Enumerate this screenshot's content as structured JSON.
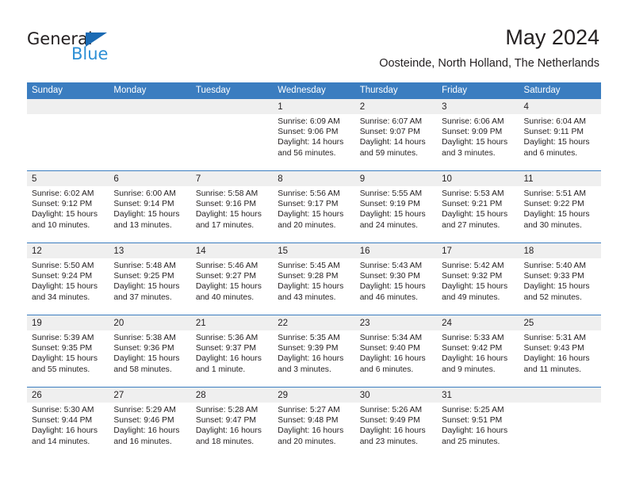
{
  "brand": {
    "name_top": "General",
    "name_bottom": "Blue",
    "triangle_color": "#1b6ab3",
    "blue_color": "#2d8fd5"
  },
  "header": {
    "title": "May 2024",
    "subtitle": "Oosteinde, North Holland, The Netherlands"
  },
  "theme": {
    "header_bg": "#3b7dc0",
    "day_band_bg": "#efefef",
    "text": "#231f20"
  },
  "weekdays": [
    "Sunday",
    "Monday",
    "Tuesday",
    "Wednesday",
    "Thursday",
    "Friday",
    "Saturday"
  ],
  "weeks": [
    [
      {
        "day": "",
        "sunrise": "",
        "sunset": "",
        "daylight1": "",
        "daylight2": ""
      },
      {
        "day": "",
        "sunrise": "",
        "sunset": "",
        "daylight1": "",
        "daylight2": ""
      },
      {
        "day": "",
        "sunrise": "",
        "sunset": "",
        "daylight1": "",
        "daylight2": ""
      },
      {
        "day": "1",
        "sunrise": "Sunrise: 6:09 AM",
        "sunset": "Sunset: 9:06 PM",
        "daylight1": "Daylight: 14 hours",
        "daylight2": "and 56 minutes."
      },
      {
        "day": "2",
        "sunrise": "Sunrise: 6:07 AM",
        "sunset": "Sunset: 9:07 PM",
        "daylight1": "Daylight: 14 hours",
        "daylight2": "and 59 minutes."
      },
      {
        "day": "3",
        "sunrise": "Sunrise: 6:06 AM",
        "sunset": "Sunset: 9:09 PM",
        "daylight1": "Daylight: 15 hours",
        "daylight2": "and 3 minutes."
      },
      {
        "day": "4",
        "sunrise": "Sunrise: 6:04 AM",
        "sunset": "Sunset: 9:11 PM",
        "daylight1": "Daylight: 15 hours",
        "daylight2": "and 6 minutes."
      }
    ],
    [
      {
        "day": "5",
        "sunrise": "Sunrise: 6:02 AM",
        "sunset": "Sunset: 9:12 PM",
        "daylight1": "Daylight: 15 hours",
        "daylight2": "and 10 minutes."
      },
      {
        "day": "6",
        "sunrise": "Sunrise: 6:00 AM",
        "sunset": "Sunset: 9:14 PM",
        "daylight1": "Daylight: 15 hours",
        "daylight2": "and 13 minutes."
      },
      {
        "day": "7",
        "sunrise": "Sunrise: 5:58 AM",
        "sunset": "Sunset: 9:16 PM",
        "daylight1": "Daylight: 15 hours",
        "daylight2": "and 17 minutes."
      },
      {
        "day": "8",
        "sunrise": "Sunrise: 5:56 AM",
        "sunset": "Sunset: 9:17 PM",
        "daylight1": "Daylight: 15 hours",
        "daylight2": "and 20 minutes."
      },
      {
        "day": "9",
        "sunrise": "Sunrise: 5:55 AM",
        "sunset": "Sunset: 9:19 PM",
        "daylight1": "Daylight: 15 hours",
        "daylight2": "and 24 minutes."
      },
      {
        "day": "10",
        "sunrise": "Sunrise: 5:53 AM",
        "sunset": "Sunset: 9:21 PM",
        "daylight1": "Daylight: 15 hours",
        "daylight2": "and 27 minutes."
      },
      {
        "day": "11",
        "sunrise": "Sunrise: 5:51 AM",
        "sunset": "Sunset: 9:22 PM",
        "daylight1": "Daylight: 15 hours",
        "daylight2": "and 30 minutes."
      }
    ],
    [
      {
        "day": "12",
        "sunrise": "Sunrise: 5:50 AM",
        "sunset": "Sunset: 9:24 PM",
        "daylight1": "Daylight: 15 hours",
        "daylight2": "and 34 minutes."
      },
      {
        "day": "13",
        "sunrise": "Sunrise: 5:48 AM",
        "sunset": "Sunset: 9:25 PM",
        "daylight1": "Daylight: 15 hours",
        "daylight2": "and 37 minutes."
      },
      {
        "day": "14",
        "sunrise": "Sunrise: 5:46 AM",
        "sunset": "Sunset: 9:27 PM",
        "daylight1": "Daylight: 15 hours",
        "daylight2": "and 40 minutes."
      },
      {
        "day": "15",
        "sunrise": "Sunrise: 5:45 AM",
        "sunset": "Sunset: 9:28 PM",
        "daylight1": "Daylight: 15 hours",
        "daylight2": "and 43 minutes."
      },
      {
        "day": "16",
        "sunrise": "Sunrise: 5:43 AM",
        "sunset": "Sunset: 9:30 PM",
        "daylight1": "Daylight: 15 hours",
        "daylight2": "and 46 minutes."
      },
      {
        "day": "17",
        "sunrise": "Sunrise: 5:42 AM",
        "sunset": "Sunset: 9:32 PM",
        "daylight1": "Daylight: 15 hours",
        "daylight2": "and 49 minutes."
      },
      {
        "day": "18",
        "sunrise": "Sunrise: 5:40 AM",
        "sunset": "Sunset: 9:33 PM",
        "daylight1": "Daylight: 15 hours",
        "daylight2": "and 52 minutes."
      }
    ],
    [
      {
        "day": "19",
        "sunrise": "Sunrise: 5:39 AM",
        "sunset": "Sunset: 9:35 PM",
        "daylight1": "Daylight: 15 hours",
        "daylight2": "and 55 minutes."
      },
      {
        "day": "20",
        "sunrise": "Sunrise: 5:38 AM",
        "sunset": "Sunset: 9:36 PM",
        "daylight1": "Daylight: 15 hours",
        "daylight2": "and 58 minutes."
      },
      {
        "day": "21",
        "sunrise": "Sunrise: 5:36 AM",
        "sunset": "Sunset: 9:37 PM",
        "daylight1": "Daylight: 16 hours",
        "daylight2": "and 1 minute."
      },
      {
        "day": "22",
        "sunrise": "Sunrise: 5:35 AM",
        "sunset": "Sunset: 9:39 PM",
        "daylight1": "Daylight: 16 hours",
        "daylight2": "and 3 minutes."
      },
      {
        "day": "23",
        "sunrise": "Sunrise: 5:34 AM",
        "sunset": "Sunset: 9:40 PM",
        "daylight1": "Daylight: 16 hours",
        "daylight2": "and 6 minutes."
      },
      {
        "day": "24",
        "sunrise": "Sunrise: 5:33 AM",
        "sunset": "Sunset: 9:42 PM",
        "daylight1": "Daylight: 16 hours",
        "daylight2": "and 9 minutes."
      },
      {
        "day": "25",
        "sunrise": "Sunrise: 5:31 AM",
        "sunset": "Sunset: 9:43 PM",
        "daylight1": "Daylight: 16 hours",
        "daylight2": "and 11 minutes."
      }
    ],
    [
      {
        "day": "26",
        "sunrise": "Sunrise: 5:30 AM",
        "sunset": "Sunset: 9:44 PM",
        "daylight1": "Daylight: 16 hours",
        "daylight2": "and 14 minutes."
      },
      {
        "day": "27",
        "sunrise": "Sunrise: 5:29 AM",
        "sunset": "Sunset: 9:46 PM",
        "daylight1": "Daylight: 16 hours",
        "daylight2": "and 16 minutes."
      },
      {
        "day": "28",
        "sunrise": "Sunrise: 5:28 AM",
        "sunset": "Sunset: 9:47 PM",
        "daylight1": "Daylight: 16 hours",
        "daylight2": "and 18 minutes."
      },
      {
        "day": "29",
        "sunrise": "Sunrise: 5:27 AM",
        "sunset": "Sunset: 9:48 PM",
        "daylight1": "Daylight: 16 hours",
        "daylight2": "and 20 minutes."
      },
      {
        "day": "30",
        "sunrise": "Sunrise: 5:26 AM",
        "sunset": "Sunset: 9:49 PM",
        "daylight1": "Daylight: 16 hours",
        "daylight2": "and 23 minutes."
      },
      {
        "day": "31",
        "sunrise": "Sunrise: 5:25 AM",
        "sunset": "Sunset: 9:51 PM",
        "daylight1": "Daylight: 16 hours",
        "daylight2": "and 25 minutes."
      },
      {
        "day": "",
        "sunrise": "",
        "sunset": "",
        "daylight1": "",
        "daylight2": ""
      }
    ]
  ]
}
